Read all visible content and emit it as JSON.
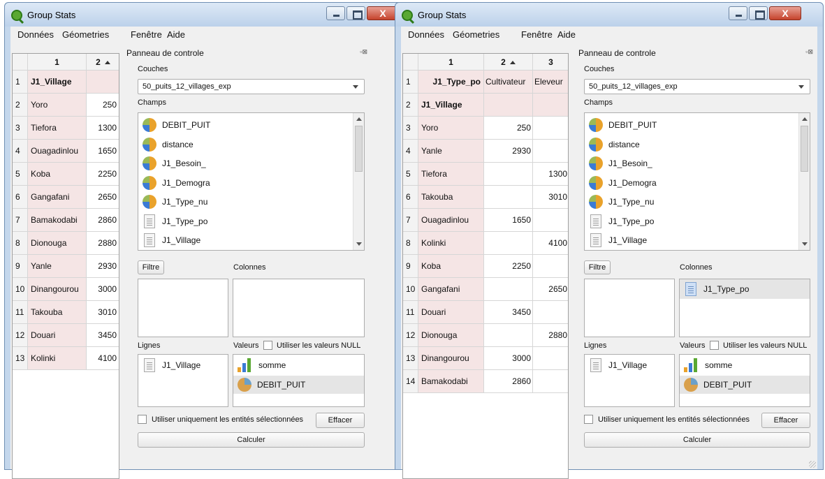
{
  "windows": [
    {
      "title": "Group Stats",
      "menu": [
        "Données",
        "Géometries",
        "Fenêtre",
        "Aide"
      ],
      "table": {
        "col_headers": [
          "1",
          "2"
        ],
        "rows": [
          {
            "n": "1",
            "name": "J1_Village",
            "v": ""
          },
          {
            "n": "2",
            "name": "Yoro",
            "v": "250"
          },
          {
            "n": "3",
            "name": "Tiefora",
            "v": "1300"
          },
          {
            "n": "4",
            "name": "Ouagadinlou",
            "v": "1650"
          },
          {
            "n": "5",
            "name": "Koba",
            "v": "2250"
          },
          {
            "n": "6",
            "name": "Gangafani",
            "v": "2650"
          },
          {
            "n": "7",
            "name": "Bamakodabi",
            "v": "2860"
          },
          {
            "n": "8",
            "name": "Dionouga",
            "v": "2880"
          },
          {
            "n": "9",
            "name": "Yanle",
            "v": "2930"
          },
          {
            "n": "10",
            "name": "Dinangourou",
            "v": "3000"
          },
          {
            "n": "11",
            "name": "Takouba",
            "v": "3010"
          },
          {
            "n": "12",
            "name": "Douari",
            "v": "3450"
          },
          {
            "n": "13",
            "name": "Kolinki",
            "v": "4100"
          }
        ]
      },
      "panel": {
        "title": "Panneau de controle",
        "couches_label": "Couches",
        "layer": "50_puits_12_villages_exp",
        "champs_label": "Champs",
        "fields": [
          {
            "name": "DEBIT_PUIT",
            "icon": "pie-icon"
          },
          {
            "name": "distance",
            "icon": "pie-icon"
          },
          {
            "name": "J1_Besoin_",
            "icon": "pie-icon"
          },
          {
            "name": "J1_Demogra",
            "icon": "pie-icon"
          },
          {
            "name": "J1_Type_nu",
            "icon": "pie-icon"
          },
          {
            "name": "J1_Type_po",
            "icon": "text-field-icon"
          },
          {
            "name": "J1_Village",
            "icon": "text-field-icon"
          }
        ],
        "filtre": "Filtre",
        "colonnes": "Colonnes",
        "colonnes_items": [],
        "lignes": "Lignes",
        "lignes_items": [
          "J1_Village"
        ],
        "valeurs": "Valeurs",
        "use_null": "Utiliser les valeurs NULL",
        "valeurs_items": [
          "somme",
          "DEBIT_PUIT"
        ],
        "use_selected": "Utiliser uniquement les entités sélectionnées",
        "effacer": "Effacer",
        "calculer": "Calculer"
      }
    },
    {
      "title": "Group Stats",
      "menu": [
        "Données",
        "Géometries",
        "Fenêtre",
        "Aide"
      ],
      "table": {
        "col_headers": [
          "1",
          "2",
          "3"
        ],
        "rows": [
          {
            "n": "1",
            "name": "J1_Type_po",
            "a": "Cultivateur",
            "b": "Eleveur"
          },
          {
            "n": "2",
            "name": "J1_Village",
            "a": "",
            "b": ""
          },
          {
            "n": "3",
            "name": "Yoro",
            "a": "250",
            "b": ""
          },
          {
            "n": "4",
            "name": "Yanle",
            "a": "2930",
            "b": ""
          },
          {
            "n": "5",
            "name": "Tiefora",
            "a": "",
            "b": "1300"
          },
          {
            "n": "6",
            "name": "Takouba",
            "a": "",
            "b": "3010"
          },
          {
            "n": "7",
            "name": "Ouagadinlou",
            "a": "1650",
            "b": ""
          },
          {
            "n": "8",
            "name": "Kolinki",
            "a": "",
            "b": "4100"
          },
          {
            "n": "9",
            "name": "Koba",
            "a": "2250",
            "b": ""
          },
          {
            "n": "10",
            "name": "Gangafani",
            "a": "",
            "b": "2650"
          },
          {
            "n": "11",
            "name": "Douari",
            "a": "3450",
            "b": ""
          },
          {
            "n": "12",
            "name": "Dionouga",
            "a": "",
            "b": "2880"
          },
          {
            "n": "13",
            "name": "Dinangourou",
            "a": "3000",
            "b": ""
          },
          {
            "n": "14",
            "name": "Bamakodabi",
            "a": "2860",
            "b": ""
          }
        ]
      },
      "panel": {
        "title": "Panneau de controle",
        "couches_label": "Couches",
        "layer": "50_puits_12_villages_exp",
        "champs_label": "Champs",
        "fields": [
          {
            "name": "DEBIT_PUIT",
            "icon": "pie-icon"
          },
          {
            "name": "distance",
            "icon": "pie-icon"
          },
          {
            "name": "J1_Besoin_",
            "icon": "pie-icon"
          },
          {
            "name": "J1_Demogra",
            "icon": "pie-icon"
          },
          {
            "name": "J1_Type_nu",
            "icon": "pie-icon"
          },
          {
            "name": "J1_Type_po",
            "icon": "text-field-icon"
          },
          {
            "name": "J1_Village",
            "icon": "text-field-icon"
          }
        ],
        "filtre": "Filtre",
        "colonnes": "Colonnes",
        "colonnes_items": [
          "J1_Type_po"
        ],
        "lignes": "Lignes",
        "lignes_items": [
          "J1_Village"
        ],
        "valeurs": "Valeurs",
        "use_null": "Utiliser les valeurs NULL",
        "valeurs_items": [
          "somme",
          "DEBIT_PUIT"
        ],
        "use_selected": "Utiliser uniquement les entités sélectionnées",
        "effacer": "Effacer",
        "calculer": "Calculer"
      }
    }
  ]
}
